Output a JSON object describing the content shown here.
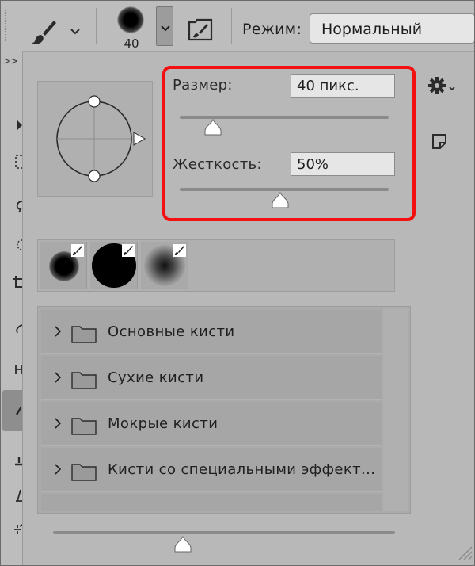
{
  "optionsbar": {
    "tool_icon": "brush-icon",
    "brush_size_value": "40",
    "mode_label": "Режим:",
    "mode_value": "Нормальный",
    "toggle_panel_icon": "brush-settings-panel-icon"
  },
  "panel": {
    "size_label": "Размер:",
    "size_value": "40 пикс.",
    "size_slider_fraction": 0.16,
    "hardness_label": "Жесткость:",
    "hardness_value": "50%",
    "hardness_slider_fraction": 0.48,
    "highlight_color": "#f21010",
    "settings_icon": "gear-icon",
    "new_preset_icon": "new-preset-icon",
    "recent_brushes": [
      {
        "icon": "soft-round-brush-icon"
      },
      {
        "icon": "hard-round-brush-icon"
      },
      {
        "icon": "soft-airbrush-icon"
      }
    ],
    "preset_groups": [
      {
        "label": "Основные кисти"
      },
      {
        "label": "Сухие кисти"
      },
      {
        "label": "Мокрые кисти"
      },
      {
        "label": "Кисти со специальными эффект..."
      }
    ],
    "preview_size_fraction": 0.38
  }
}
